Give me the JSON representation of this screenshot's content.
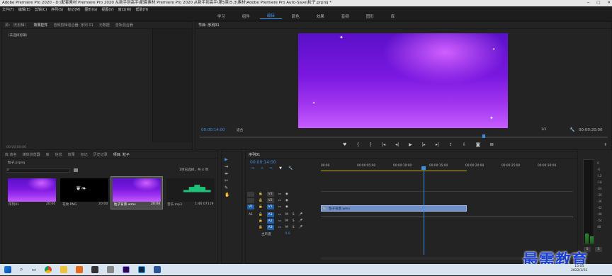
{
  "window": {
    "title": "Adobe Premiere Pro 2020 - D:\\配套素材 Premiere Pro 2020 从新手到高手\\配套素材 Premiere Pro 2020 从新手到高手\\第5章\\5.3\\素材\\Adobe Premiere Pro Auto-Save\\粒子.prproj *"
  },
  "menu": [
    "文件(F)",
    "编辑(E)",
    "剪辑(C)",
    "序列(S)",
    "标记(M)",
    "图形(G)",
    "视图(V)",
    "窗口(W)",
    "帮助(H)"
  ],
  "workspaces": [
    "学习",
    "组件",
    "编辑",
    "颜色",
    "效果",
    "音频",
    "图形",
    "库"
  ],
  "workspace_active": "编辑",
  "source_panel": {
    "tabs": [
      "源：（无剪辑）",
      "效果控件",
      "音频剪辑混合器: 序列 01",
      "元数据",
      "音轨混合器"
    ],
    "empty_text": "（未选择剪辑）",
    "timecode": "00:00:00:00"
  },
  "program_panel": {
    "tab": "节目: 序列01",
    "timecode": "00:00:14:00",
    "fit": "适合",
    "ratio": "1/2",
    "duration": "00:00:20:00"
  },
  "project_panel": {
    "tabs": [
      "库 命名",
      "媒体浏览器",
      "库",
      "信息",
      "效果",
      "标记",
      "历史记录",
      "项目: 粒子"
    ],
    "file": "粒子.prproj",
    "selection": "1项已选择，共 4 项",
    "items": [
      {
        "name": "序列01",
        "duration": "20:00"
      },
      {
        "name": "花纹.PNG",
        "duration": "20:00"
      },
      {
        "name": "粒子背景.wmv",
        "duration": "20:00"
      },
      {
        "name": "音乐.mp3",
        "duration": "1:46:07119"
      }
    ]
  },
  "timeline": {
    "tab": "序列01",
    "timecode": "00:00:14:00",
    "ruler": [
      "00:00",
      "00:00:05:00",
      "00:00:10:00",
      "00:00:15:00",
      "00:00:20:00",
      "00:00:25:00",
      "00:00:30:00"
    ],
    "video_tracks": [
      "V3",
      "V2",
      "V1"
    ],
    "audio_tracks": [
      "A1",
      "A2",
      "A3"
    ],
    "source_patch_v": "V1",
    "source_patch_a": "A1",
    "master": "主声道",
    "master_value": "0.0",
    "clip_label": "粒子背景.wmv"
  },
  "meter_labels": [
    "0",
    "-6",
    "-12",
    "-18",
    "-24",
    "-30",
    "-36",
    "-42",
    "-48",
    "-54",
    "dB"
  ],
  "meter_footer": [
    "S",
    "S"
  ],
  "watermark": "最需教育",
  "clock": {
    "time": "15:05",
    "date": "2022/3/31"
  },
  "colors": {
    "accent": "#3e8ee6",
    "clip": "#6f90c8",
    "playhead": "#3e8ee6"
  }
}
